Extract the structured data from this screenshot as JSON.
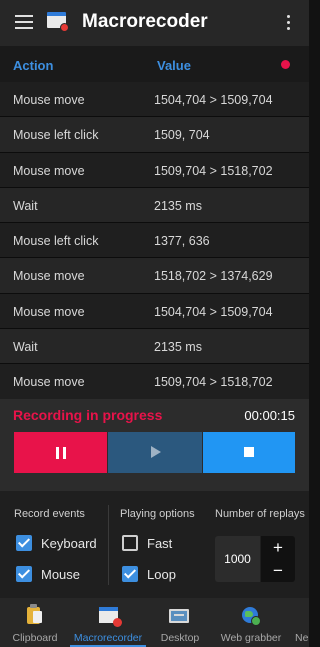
{
  "app": {
    "title": "Macrorecoder"
  },
  "table": {
    "headers": {
      "action": "Action",
      "value": "Value"
    },
    "rows": [
      {
        "action": "Mouse move",
        "value": "1504,704 > 1509,704"
      },
      {
        "action": "Mouse left click",
        "value": "1509, 704"
      },
      {
        "action": "Mouse move",
        "value": "1509,704 > 1518,702"
      },
      {
        "action": "Wait",
        "value": "2135 ms"
      },
      {
        "action": "Mouse left click",
        "value": "1377, 636"
      },
      {
        "action": "Mouse move",
        "value": "1518,702 > 1374,629"
      },
      {
        "action": "Mouse move",
        "value": "1504,704 > 1509,704"
      },
      {
        "action": "Wait",
        "value": "2135 ms"
      },
      {
        "action": "Mouse move",
        "value": "1509,704 > 1518,702"
      }
    ]
  },
  "recording": {
    "status": "Recording in progress",
    "elapsed": "00:00:15"
  },
  "controls": {
    "pause": "pause-icon",
    "play": "play-icon",
    "stop": "stop-icon"
  },
  "options": {
    "record_events": {
      "heading": "Record events",
      "keyboard": {
        "label": "Keyboard",
        "checked": true
      },
      "mouse": {
        "label": "Mouse",
        "checked": true
      }
    },
    "playing_options": {
      "heading": "Playing options",
      "fast": {
        "label": "Fast",
        "checked": false
      },
      "loop": {
        "label": "Loop",
        "checked": true
      }
    },
    "replays": {
      "heading": "Number of replays",
      "value": "1000",
      "plus": "+",
      "minus": "−"
    }
  },
  "bottom_nav": [
    {
      "label": "Clipboard",
      "icon": "clipboard-icon",
      "active": false
    },
    {
      "label": "Macrorecorder",
      "icon": "macrorecorder-icon",
      "active": true
    },
    {
      "label": "Desktop",
      "icon": "desktop-icon",
      "active": false
    },
    {
      "label": "Web grabber",
      "icon": "globe-icon",
      "active": false
    },
    {
      "label": "Ne",
      "icon": "",
      "active": false
    }
  ],
  "colors": {
    "accent": "#3d8fe0",
    "record": "#e8134a",
    "play": "#2b587e",
    "stop": "#2196f3"
  }
}
